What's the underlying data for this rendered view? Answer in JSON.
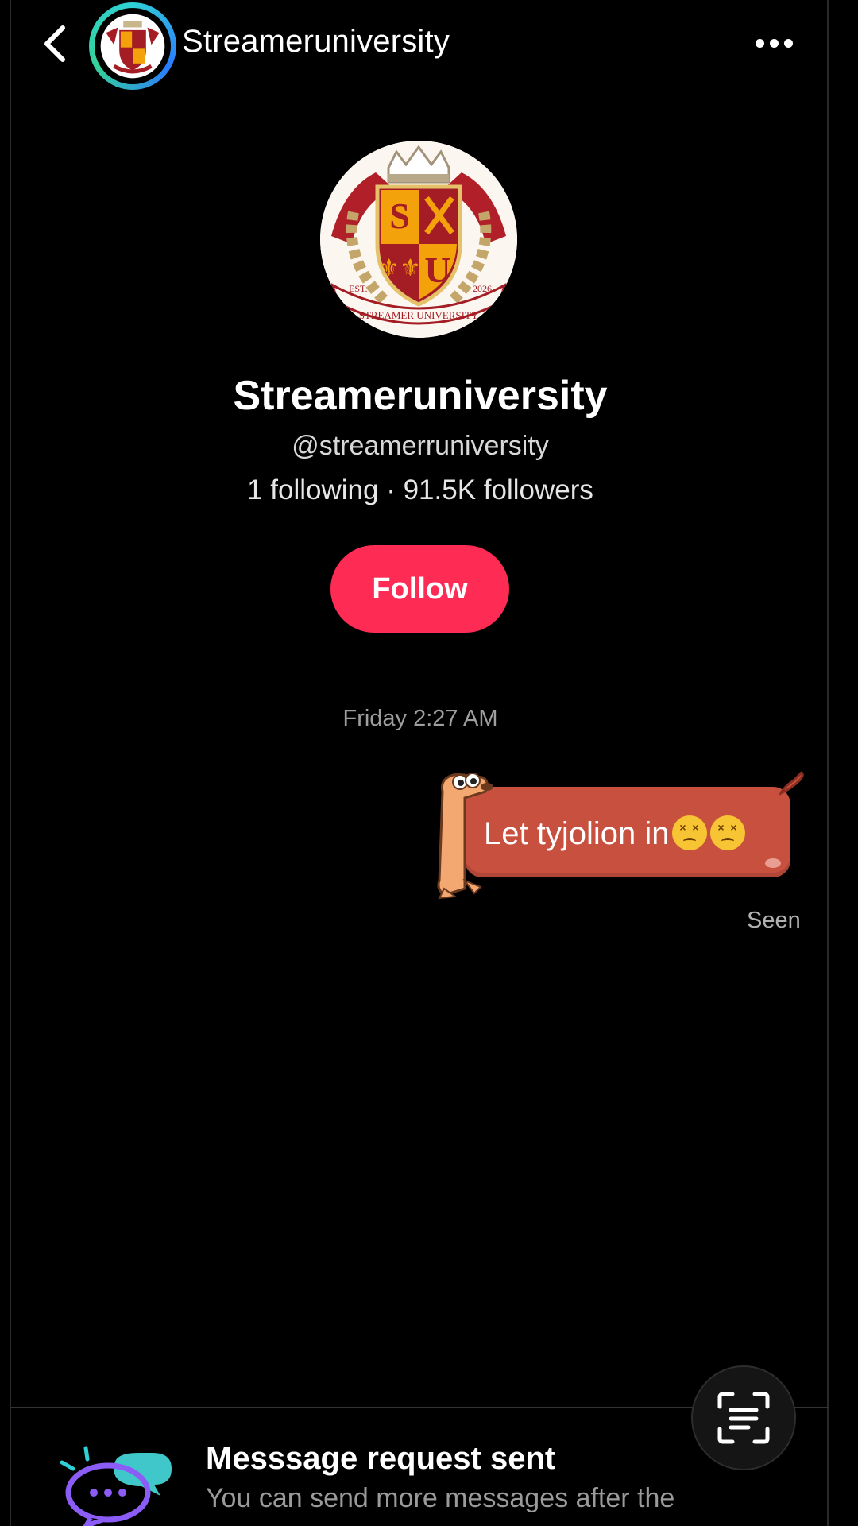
{
  "header": {
    "title": "Streameruniversity",
    "icons": [
      "back-chevron-icon",
      "more-dots-icon"
    ]
  },
  "profile": {
    "logo_text": {
      "s": "S",
      "u": "U",
      "est": "EST.",
      "year": "2026",
      "ribbon": "STREAMER UNIVERSITY"
    },
    "name": "Streameruniversity",
    "handle": "@streamerruniversity",
    "stats": "1 following · 91.5K followers",
    "follow_label": "Follow"
  },
  "chat": {
    "timestamp": "Friday 2:27 AM",
    "message": {
      "text": "Let tyjolion in",
      "emojis": [
        "confounded-face",
        "confounded-face"
      ]
    },
    "status": "Seen"
  },
  "request": {
    "title": "Messsage request sent",
    "subtitle": "You can send more messages after the"
  },
  "colors": {
    "follow": "#fe2c55",
    "bubble": "#c8503f",
    "avatar_ring": "#2fd0d6"
  }
}
